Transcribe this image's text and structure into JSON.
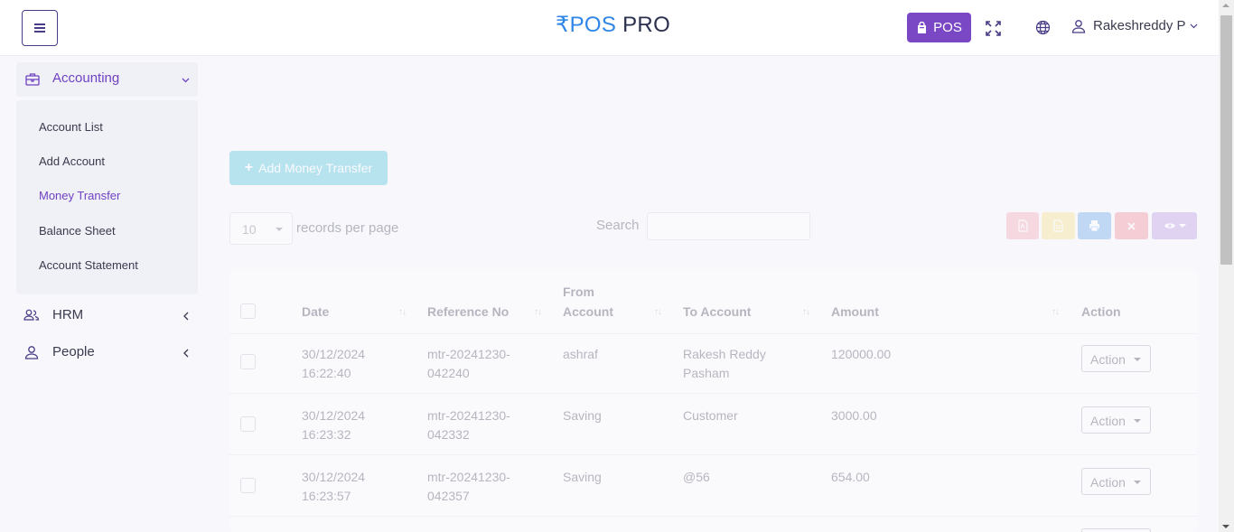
{
  "header": {
    "brand_part1": "₹POS",
    "brand_part2": " PRO",
    "pos_label": "POS",
    "user_name": "Rakeshreddy P"
  },
  "sidebar": {
    "accounting_label": "Accounting",
    "items": [
      {
        "label": "Account List"
      },
      {
        "label": "Add Account"
      },
      {
        "label": "Money Transfer"
      },
      {
        "label": "Balance Sheet"
      },
      {
        "label": "Account Statement"
      }
    ],
    "hrm_label": "HRM",
    "people_label": "People"
  },
  "toolbar": {
    "add_label": "Add Money Transfer",
    "per_page_value": "10",
    "per_page_label": "records per page",
    "search_label": "Search"
  },
  "table": {
    "headers": {
      "date": "Date",
      "reference": "Reference No",
      "from_line1": "From",
      "from_line2": "Account",
      "to": "To Account",
      "amount": "Amount",
      "action": "Action"
    },
    "rows": [
      {
        "date1": "30/12/2024",
        "date2": "16:22:40",
        "ref1": "mtr-20241230-",
        "ref2": "042240",
        "from": "ashraf",
        "to1": "Rakesh Reddy",
        "to2": "Pasham",
        "amount": "120000.00",
        "action": "Action"
      },
      {
        "date1": "30/12/2024",
        "date2": "16:23:32",
        "ref1": "mtr-20241230-",
        "ref2": "042332",
        "from": "Saving",
        "to1": "Customer",
        "to2": "",
        "amount": "3000.00",
        "action": "Action"
      },
      {
        "date1": "30/12/2024",
        "date2": "16:23:57",
        "ref1": "mtr-20241230-",
        "ref2": "042357",
        "from": "Saving",
        "to1": "@56",
        "to2": "",
        "amount": "654.00",
        "action": "Action"
      }
    ]
  },
  "colors": {
    "accent": "#6f42c1",
    "pos_button": "#7a48c4",
    "add_button": "#3fbcd5",
    "pdf_button": "#f3a0ac",
    "csv_button": "#f6dd7d",
    "print_button": "#5b9ee6",
    "clear_button": "#ef7f8c",
    "visibility_button": "#b48fe0"
  }
}
